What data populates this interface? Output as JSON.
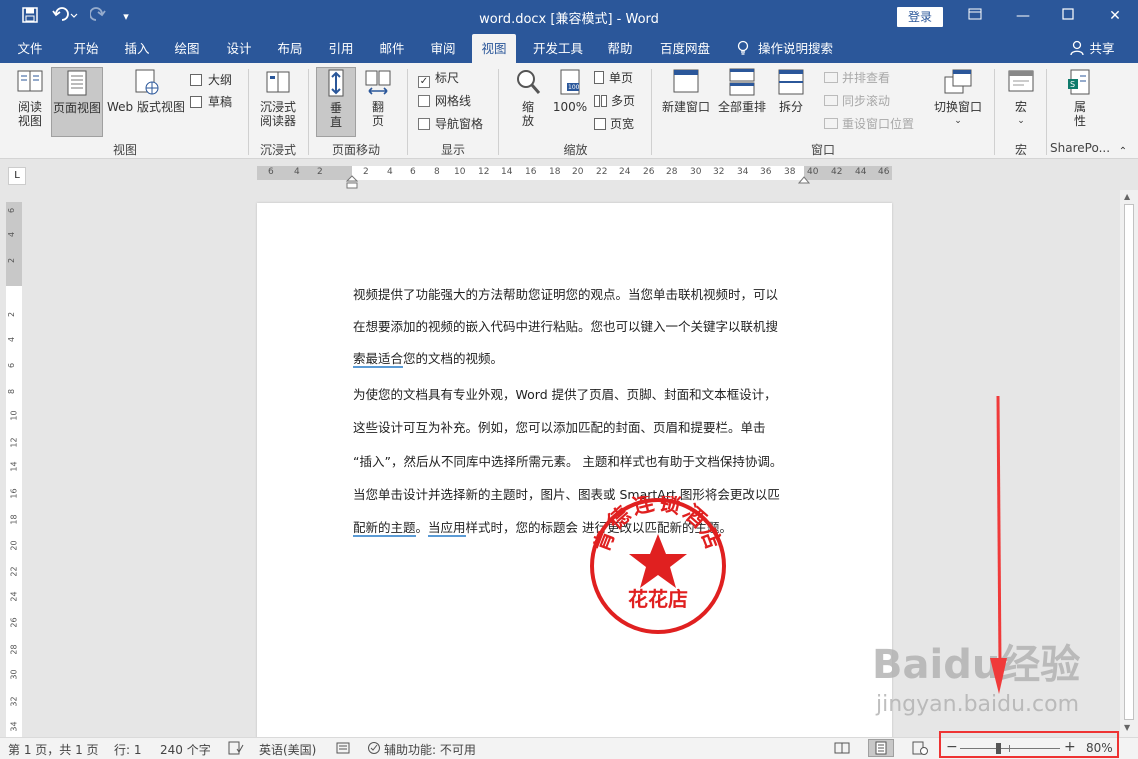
{
  "titlebar": {
    "doc_title": "word.docx [兼容模式]  -  Word",
    "login": "登录",
    "save_icon": "save-icon",
    "undo_icon": "undo-icon",
    "redo_icon": "redo-icon"
  },
  "tabs": [
    {
      "label": "文件"
    },
    {
      "label": "开始"
    },
    {
      "label": "插入"
    },
    {
      "label": "绘图"
    },
    {
      "label": "设计"
    },
    {
      "label": "布局"
    },
    {
      "label": "引用"
    },
    {
      "label": "邮件"
    },
    {
      "label": "审阅"
    },
    {
      "label": "视图"
    },
    {
      "label": "开发工具"
    },
    {
      "label": "帮助"
    },
    {
      "label": "百度网盘"
    },
    {
      "label": "操作说明搜索"
    }
  ],
  "share": "共享",
  "ribbon": {
    "read_view": "阅读\n视图",
    "read_view_1": "阅读",
    "read_view_2": "视图",
    "print_layout": "页面视图",
    "web_layout": "Web 版式视图",
    "outline": "大纲",
    "draft": "草稿",
    "group_views": "视图",
    "immersive_1": "沉浸式",
    "immersive_2": "阅读器",
    "group_immersive": "沉浸式",
    "vertical_1": "垂",
    "vertical_2": "直",
    "flip_1": "翻",
    "flip_2": "页",
    "group_page_move": "页面移动",
    "ruler": "标尺",
    "gridlines": "网格线",
    "nav_pane": "导航窗格",
    "group_show": "显示",
    "zoom_1": "缩",
    "zoom_2": "放",
    "zoom_100": "100%",
    "one_page": "单页",
    "multi_page": "多页",
    "page_width": "页宽",
    "group_zoom": "缩放",
    "new_window": "新建窗口",
    "arrange_all": "全部重排",
    "split": "拆分",
    "side_by_side": "并排查看",
    "sync_scroll": "同步滚动",
    "reset_window": "重设窗口位置",
    "switch_window": "切换窗口",
    "group_window": "窗口",
    "macro": "宏",
    "group_macro": "宏",
    "props_1": "属",
    "props_2": "性",
    "group_sharepoint": "SharePo..."
  },
  "hruler_labels": [
    "6",
    "4",
    "2",
    "2",
    "4",
    "6",
    "8",
    "10",
    "12",
    "14",
    "16",
    "18",
    "20",
    "22",
    "24",
    "26",
    "28",
    "30",
    "32",
    "34",
    "36",
    "38",
    "40",
    "42",
    "44",
    "46"
  ],
  "vruler_labels": [
    "6",
    "4",
    "2",
    "2",
    "4",
    "6",
    "8",
    "10",
    "12",
    "14",
    "16",
    "18",
    "20",
    "22",
    "24",
    "26",
    "28",
    "30",
    "32",
    "34"
  ],
  "document": {
    "p1_l1": "视频提供了功能强大的方法帮助您证明您的观点。当您单击联机视频时，可以",
    "p1_l2": "在想要添加的视频的嵌入代码中进行粘贴。您也可以键入一个关键字以联机搜",
    "p1_l3a": "索最适合",
    "p1_l3b": "您的文档的视频。",
    "p2_l1": "为使您的文档具有专业外观，Word 提供了页眉、页脚、封面和文本框设计，",
    "p2_l2": "这些设计可互为补充。例如，您可以添加匹配的封面、页眉和提要栏。单击",
    "p2_l3": "“插入”，然后从不同库中选择所需元素。 主题和样式也有助于文档保持协调。",
    "p2_l4": "当您单击设计并选择新的主题时，图片、图表或 SmartArt 图形将会更改以匹",
    "p2_l5a": "配新的主题",
    "p2_l5b": "。",
    "p2_l5c": "当应用",
    "p2_l5d": "样式时，您的标题会 进行更改以匹配新的主题。"
  },
  "seal": {
    "arc_text": "肯德连锁酒店",
    "bottom_text": "花花店",
    "color": "#e02020"
  },
  "watermark": {
    "brand": "Baidu经验",
    "url": "jingyan.baidu.com"
  },
  "status": {
    "page": "第 1 页，共 1 页",
    "line": "行: 1",
    "words": "240 个字",
    "language": "英语(美国)",
    "accessibility": "辅助功能: 不可用",
    "zoom": "80%",
    "zoom_minus": "−",
    "zoom_plus": "+"
  },
  "colors": {
    "accent": "#2b579a",
    "highlight_box": "#e33333",
    "arrow": "#f03a3a"
  }
}
